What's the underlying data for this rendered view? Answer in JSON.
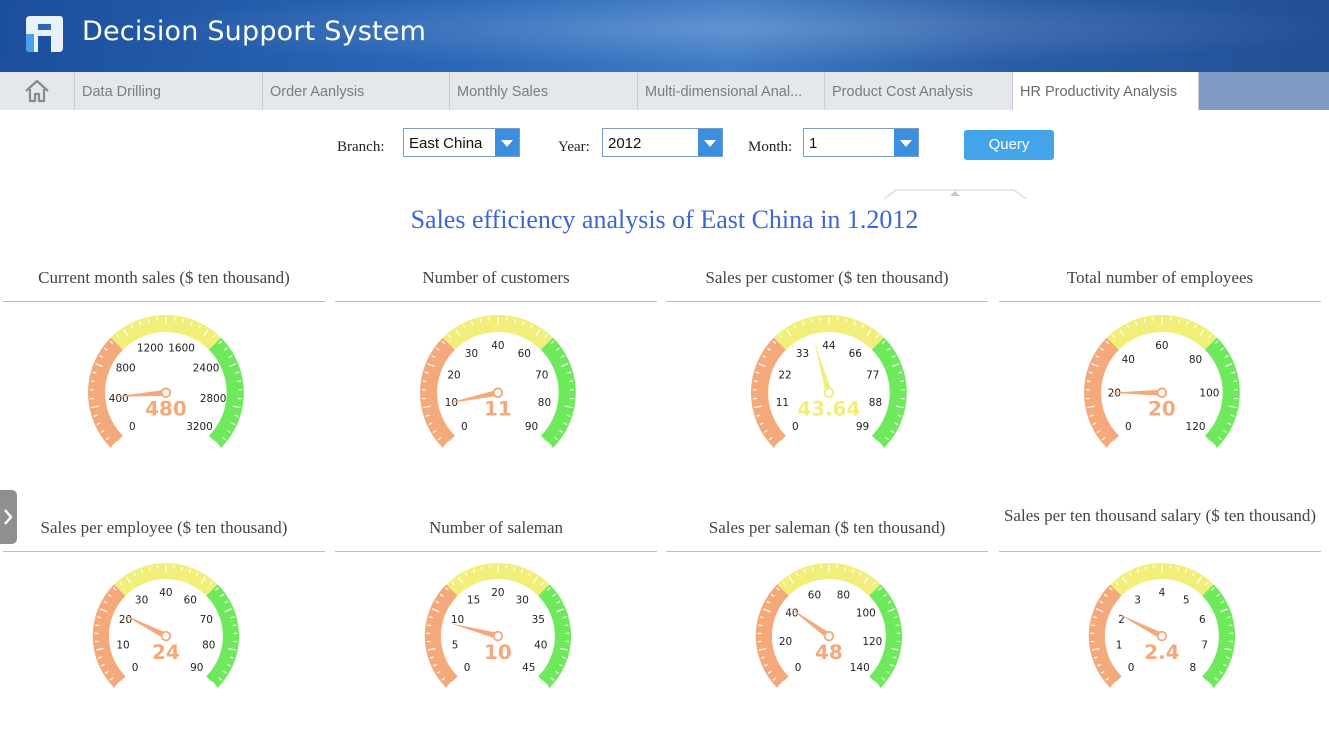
{
  "app": {
    "title": "Decision Support System"
  },
  "tabs": [
    {
      "label": "Data Drilling",
      "active": false
    },
    {
      "label": "Order Aanlysis",
      "active": false
    },
    {
      "label": "Monthly Sales",
      "active": false
    },
    {
      "label": "Multi-dimensional Anal...",
      "active": false
    },
    {
      "label": "Product Cost Analysis",
      "active": false
    },
    {
      "label": "HR Productivity Analysis",
      "active": true
    }
  ],
  "home_icon": "home-icon",
  "filters": {
    "branch_label": "Branch:",
    "branch_value": "East China",
    "year_label": "Year:",
    "year_value": "2012",
    "month_label": "Month:",
    "month_value": "1",
    "query_label": "Query"
  },
  "main_title": "Sales efficiency analysis of East China in 1.2012",
  "colors": {
    "low": "#f4a97a",
    "mid": "#f1ee7a",
    "high": "#6de95b",
    "title_blue": "#3a66d8",
    "button": "#44a4ea"
  },
  "gauges": [
    {
      "title": "Current month sales ($ ten thousand)",
      "min": 0,
      "max": 3200,
      "value": 480,
      "value_label": "480",
      "ticks": [
        "0",
        "400",
        "800",
        "1200",
        "1600",
        "2400",
        "2800",
        "3200"
      ],
      "value_color": "#f4a97a"
    },
    {
      "title": "Number of customers",
      "min": 0,
      "max": 90,
      "value": 11,
      "value_label": "11",
      "ticks": [
        "0",
        "10",
        "20",
        "30",
        "40",
        "60",
        "70",
        "80",
        "90"
      ],
      "value_color": "#f4a97a"
    },
    {
      "title": "Sales per customer ($ ten thousand)",
      "min": 0,
      "max": 99,
      "value": 43.64,
      "value_label": "43.64",
      "ticks": [
        "0",
        "11",
        "22",
        "33",
        "44",
        "66",
        "77",
        "88",
        "99"
      ],
      "value_color": "#f1ee7a"
    },
    {
      "title": "Total number of employees",
      "min": 0,
      "max": 120,
      "value": 20,
      "value_label": "20",
      "ticks": [
        "0",
        "20",
        "40",
        "60",
        "80",
        "100",
        "120"
      ],
      "value_color": "#f4a97a"
    },
    {
      "title": "Sales per employee ($ ten thousand)",
      "min": 0,
      "max": 90,
      "value": 24,
      "value_label": "24",
      "ticks": [
        "0",
        "10",
        "20",
        "30",
        "40",
        "60",
        "70",
        "80",
        "90"
      ],
      "value_color": "#f4a97a"
    },
    {
      "title": "Number of saleman",
      "min": 0,
      "max": 45,
      "value": 10,
      "value_label": "10",
      "ticks": [
        "0",
        "5",
        "10",
        "15",
        "20",
        "30",
        "35",
        "40",
        "45"
      ],
      "value_color": "#f4a97a"
    },
    {
      "title": "Sales per saleman ($ ten thousand)",
      "min": 0,
      "max": 160,
      "value": 48,
      "value_label": "48",
      "ticks": [
        "0",
        "20",
        "40",
        "60",
        "80",
        "100",
        "120",
        "140"
      ],
      "value_color": "#f4a97a"
    },
    {
      "title": "Sales per ten thousand salary ($ ten thousand)",
      "min": 0,
      "max": 9,
      "value": 2.4,
      "value_label": "2.4",
      "ticks": [
        "0",
        "1",
        "2",
        "3",
        "4",
        "5",
        "6",
        "7",
        "8"
      ],
      "value_color": "#f4a97a"
    }
  ]
}
